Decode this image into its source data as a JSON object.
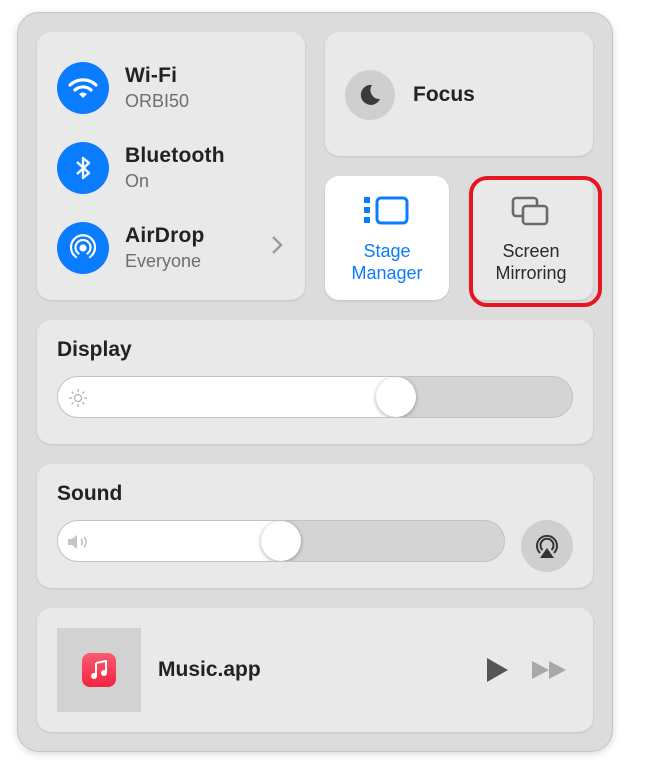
{
  "connectivity": {
    "items": [
      {
        "label": "Wi-Fi",
        "status": "ORBI50",
        "icon": "wifi-icon"
      },
      {
        "label": "Bluetooth",
        "status": "On",
        "icon": "bluetooth-icon"
      },
      {
        "label": "AirDrop",
        "status": "Everyone",
        "icon": "airdrop-icon"
      }
    ]
  },
  "focus": {
    "label": "Focus",
    "icon": "moon-icon"
  },
  "stage_manager": {
    "label_line1": "Stage",
    "label_line2": "Manager",
    "icon": "stage-manager-icon",
    "color": "#0a7cff"
  },
  "screen_mirroring": {
    "label_line1": "Screen",
    "label_line2": "Mirroring",
    "icon": "screen-mirroring-icon",
    "highlight_color": "#e8141f"
  },
  "display": {
    "label": "Display",
    "brightness": 0.67
  },
  "sound": {
    "label": "Sound",
    "volume": 0.5
  },
  "now_playing": {
    "app": "Music.app",
    "icon": "music-icon"
  }
}
